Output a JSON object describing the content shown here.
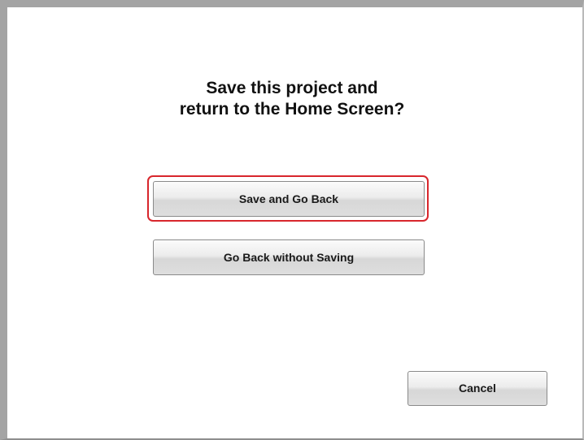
{
  "dialog": {
    "title_line1": "Save this project and",
    "title_line2": "return to the Home Screen?"
  },
  "buttons": {
    "save_label": "Save and Go Back",
    "nosave_label": "Go Back without Saving",
    "cancel_label": "Cancel"
  },
  "colors": {
    "focus_ring": "#d8262c",
    "frame_border": "#a4a4a4"
  }
}
